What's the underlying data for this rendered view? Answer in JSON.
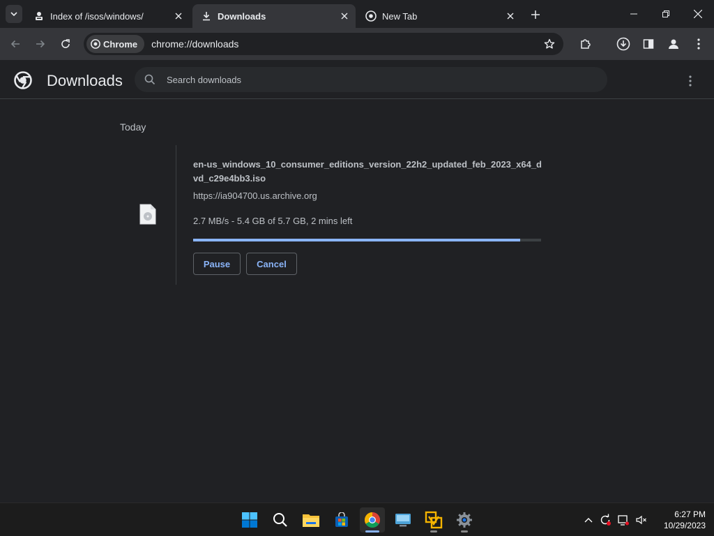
{
  "browser": {
    "tabs": [
      {
        "label": "Index of /isos/windows/",
        "active": false
      },
      {
        "label": "Downloads",
        "active": true
      },
      {
        "label": "New Tab",
        "active": false
      }
    ],
    "chip_label": "Chrome",
    "url": "chrome://downloads"
  },
  "downloads_page": {
    "title": "Downloads",
    "search_placeholder": "Search downloads",
    "group_label": "Today",
    "items": [
      {
        "filename": "en-us_windows_10_consumer_editions_version_22h2_updated_feb_2023_x64_dvd_c29e4bb3.iso",
        "source": "https://ia904700.us.archive.org",
        "status": "2.7 MB/s - 5.4 GB of 5.7 GB, 2 mins left",
        "progress": 0.94,
        "pause_label": "Pause",
        "cancel_label": "Cancel"
      }
    ]
  },
  "taskbar": {
    "apps": [
      "start-icon",
      "search-icon",
      "file-explorer-icon",
      "microsoft-store-icon",
      "chrome-icon",
      "remote-desktop-icon",
      "vmware-icon",
      "settings-icon"
    ],
    "time": "6:27 PM",
    "date": "10/29/2023"
  },
  "colors": {
    "background": "#202124",
    "toolbar": "#35363a",
    "accent": "#8ab4f8"
  }
}
